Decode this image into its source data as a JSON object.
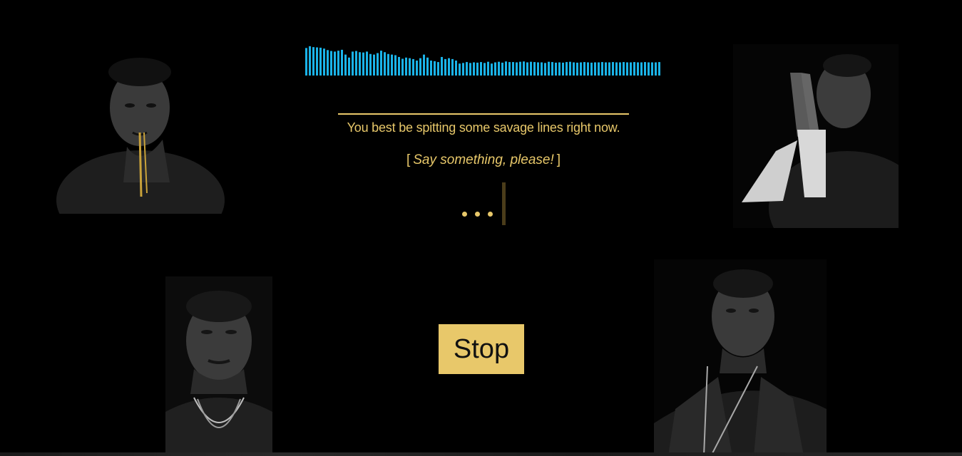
{
  "waveform": {
    "color": "#1ab3e8",
    "levels": [
      0.92,
      0.98,
      0.95,
      0.94,
      0.93,
      0.9,
      0.85,
      0.82,
      0.8,
      0.83,
      0.86,
      0.7,
      0.6,
      0.8,
      0.82,
      0.78,
      0.77,
      0.8,
      0.72,
      0.7,
      0.75,
      0.83,
      0.78,
      0.72,
      0.7,
      0.68,
      0.62,
      0.56,
      0.6,
      0.58,
      0.55,
      0.5,
      0.58,
      0.7,
      0.6,
      0.5,
      0.48,
      0.45,
      0.62,
      0.55,
      0.58,
      0.55,
      0.5,
      0.4,
      0.42,
      0.45,
      0.42,
      0.44,
      0.43,
      0.45,
      0.42,
      0.46,
      0.4,
      0.44,
      0.46,
      0.43,
      0.47,
      0.45,
      0.45,
      0.44,
      0.46,
      0.47,
      0.44,
      0.46,
      0.45,
      0.44,
      0.44,
      0.42,
      0.46,
      0.45,
      0.43,
      0.44,
      0.43,
      0.45,
      0.46,
      0.44,
      0.43,
      0.44,
      0.45,
      0.44,
      0.43,
      0.44,
      0.44,
      0.45,
      0.44,
      0.44,
      0.45,
      0.44,
      0.44,
      0.45,
      0.44,
      0.44,
      0.45,
      0.44,
      0.44,
      0.45,
      0.44,
      0.44,
      0.44,
      0.45
    ]
  },
  "prompt": {
    "text": "You best be spitting some savage lines right now.",
    "open_bracket": "[",
    "hint": "Say something, please!",
    "close_bracket": "]"
  },
  "status": {
    "listening_indicator": "..."
  },
  "controls": {
    "stop_label": "Stop"
  },
  "colors": {
    "accent": "#e8c86a",
    "background": "#000000",
    "waveform": "#1ab3e8"
  },
  "portraits": [
    {
      "position": "top-left",
      "alt": "rapper-portrait"
    },
    {
      "position": "top-right",
      "alt": "rapper-portrait"
    },
    {
      "position": "bottom-left",
      "alt": "rapper-portrait"
    },
    {
      "position": "bottom-right",
      "alt": "rapper-portrait"
    }
  ]
}
